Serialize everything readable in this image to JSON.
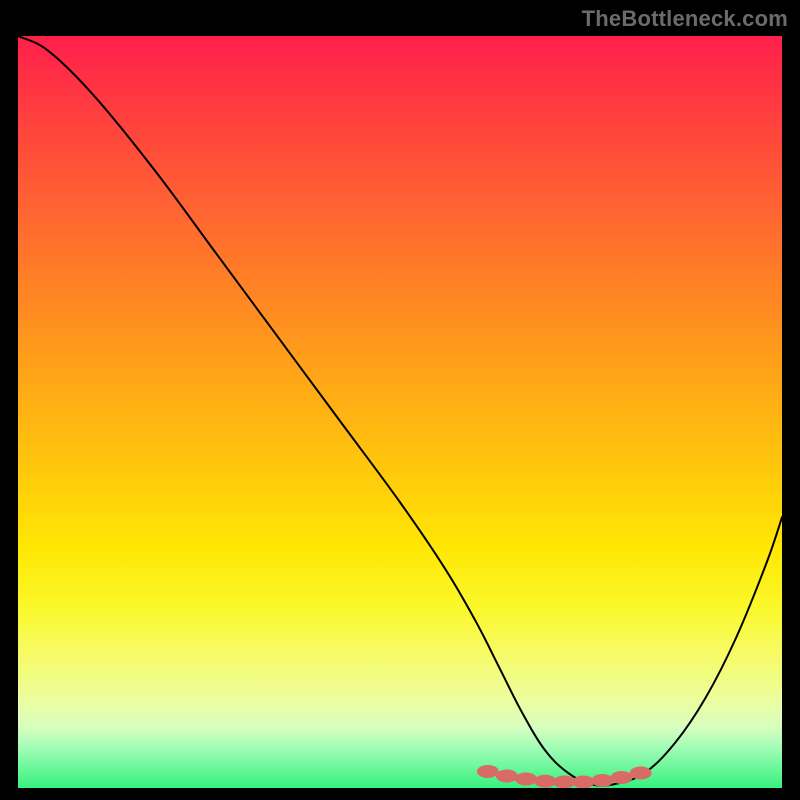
{
  "watermark": "TheBottleneck.com",
  "chart_data": {
    "type": "line",
    "title": "",
    "xlabel": "",
    "ylabel": "",
    "xlim": [
      0,
      100
    ],
    "ylim": [
      0,
      100
    ],
    "series": [
      {
        "name": "curve",
        "x": [
          0,
          4,
          10,
          18,
          26,
          34,
          42,
          50,
          56,
          60,
          63,
          66,
          69,
          72,
          75,
          78,
          82,
          86,
          90,
          94,
          98,
          100
        ],
        "y": [
          100,
          98,
          92,
          82,
          71,
          60,
          49,
          38,
          29,
          22,
          16,
          10,
          5,
          2,
          0.5,
          0.5,
          2,
          6,
          12,
          20,
          30,
          36
        ]
      }
    ],
    "markers": {
      "name": "highlight-points",
      "x": [
        61.5,
        64,
        66.5,
        69,
        71.5,
        74,
        76.5,
        79,
        81.5
      ],
      "y": [
        2.2,
        1.6,
        1.2,
        0.9,
        0.8,
        0.8,
        1.0,
        1.4,
        2.0
      ]
    },
    "gradient_stops": [
      {
        "pos": 0,
        "color": "#ff1f4b"
      },
      {
        "pos": 10,
        "color": "#ff3d3f"
      },
      {
        "pos": 22,
        "color": "#ff6133"
      },
      {
        "pos": 34,
        "color": "#ff8424"
      },
      {
        "pos": 46,
        "color": "#ffa817"
      },
      {
        "pos": 58,
        "color": "#ffc90b"
      },
      {
        "pos": 68,
        "color": "#ffe704"
      },
      {
        "pos": 76,
        "color": "#fbf82a"
      },
      {
        "pos": 82,
        "color": "#f6fb65"
      },
      {
        "pos": 88,
        "color": "#eefd9c"
      },
      {
        "pos": 92,
        "color": "#d7fec0"
      },
      {
        "pos": 95,
        "color": "#99fcb3"
      },
      {
        "pos": 100,
        "color": "#36f17e"
      }
    ]
  }
}
